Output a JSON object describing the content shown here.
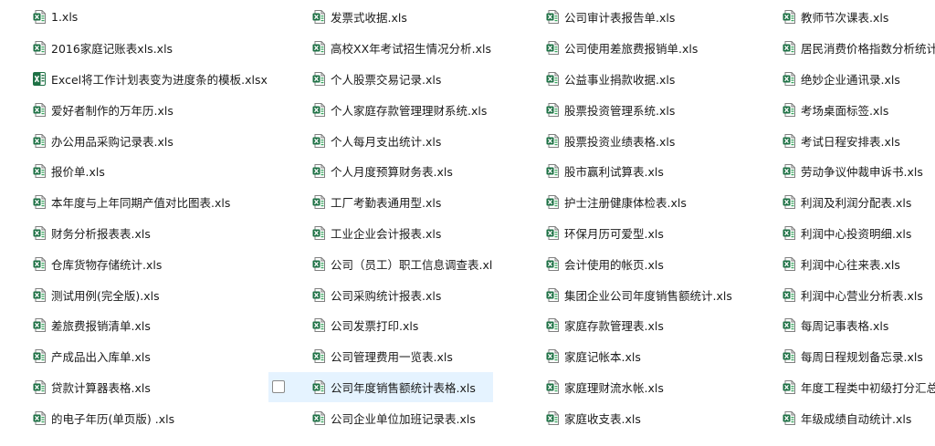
{
  "columns": [
    {
      "files": [
        {
          "name": "1.xls",
          "icon": "excel-file-icon"
        },
        {
          "name": "2016家庭记账表xls.xls",
          "icon": "excel-file-icon"
        },
        {
          "name": "Excel将工作计划表变为进度条的模板.xlsx",
          "icon": "excel-xlsx-file-icon"
        },
        {
          "name": "爱好者制作的万年历.xls",
          "icon": "excel-file-icon"
        },
        {
          "name": "办公用品采购记录表.xls",
          "icon": "excel-file-icon"
        },
        {
          "name": "报价单.xls",
          "icon": "excel-file-icon"
        },
        {
          "name": "本年度与上年同期产值对比图表.xls",
          "icon": "excel-file-icon"
        },
        {
          "name": "财务分析报表表.xls",
          "icon": "excel-file-icon"
        },
        {
          "name": "仓库货物存储统计.xls",
          "icon": "excel-file-icon"
        },
        {
          "name": "测试用例(完全版).xls",
          "icon": "excel-file-icon"
        },
        {
          "name": "差旅费报销清单.xls",
          "icon": "excel-file-icon"
        },
        {
          "name": "产成品出入库单.xls",
          "icon": "excel-file-icon"
        },
        {
          "name": "贷款计算器表格.xls",
          "icon": "excel-file-icon"
        },
        {
          "name": "的电子年历(单页版) .xls",
          "icon": "excel-file-icon"
        }
      ]
    },
    {
      "files": [
        {
          "name": "发票式收据.xls",
          "icon": "excel-file-icon"
        },
        {
          "name": "高校XX年考试招生情况分析.xls",
          "icon": "excel-file-icon"
        },
        {
          "name": "个人股票交易记录.xls",
          "icon": "excel-file-icon"
        },
        {
          "name": "个人家庭存款管理理财系统.xls",
          "icon": "excel-file-icon"
        },
        {
          "name": "个人每月支出统计.xls",
          "icon": "excel-file-icon"
        },
        {
          "name": "个人月度预算财务表.xls",
          "icon": "excel-file-icon"
        },
        {
          "name": "工厂考勤表通用型.xls",
          "icon": "excel-file-icon"
        },
        {
          "name": "工业企业会计报表.xls",
          "icon": "excel-file-icon"
        },
        {
          "name": "公司（员工）职工信息调查表.xls",
          "icon": "excel-file-icon"
        },
        {
          "name": "公司采购统计报表.xls",
          "icon": "excel-file-icon"
        },
        {
          "name": "公司发票打印.xls",
          "icon": "excel-file-icon"
        },
        {
          "name": "公司管理费用一览表.xls",
          "icon": "excel-file-icon"
        },
        {
          "name": "公司年度销售额统计表格.xls",
          "icon": "excel-file-icon",
          "hovered": true
        },
        {
          "name": "公司企业单位加班记录表.xls",
          "icon": "excel-file-icon"
        }
      ]
    },
    {
      "files": [
        {
          "name": "公司审计表报告单.xls",
          "icon": "excel-file-icon"
        },
        {
          "name": "公司使用差旅费报销单.xls",
          "icon": "excel-file-icon"
        },
        {
          "name": "公益事业捐款收据.xls",
          "icon": "excel-file-icon"
        },
        {
          "name": "股票投资管理系统.xls",
          "icon": "excel-file-icon"
        },
        {
          "name": "股票投资业绩表格.xls",
          "icon": "excel-file-icon"
        },
        {
          "name": "股市赢利试算表.xls",
          "icon": "excel-file-icon"
        },
        {
          "name": "护士注册健康体检表.xls",
          "icon": "excel-file-icon"
        },
        {
          "name": "环保月历可爱型.xls",
          "icon": "excel-file-icon"
        },
        {
          "name": "会计使用的帐页.xls",
          "icon": "excel-file-icon"
        },
        {
          "name": "集团企业公司年度销售额统计.xls",
          "icon": "excel-file-icon"
        },
        {
          "name": "家庭存款管理表.xls",
          "icon": "excel-file-icon"
        },
        {
          "name": "家庭记帐本.xls",
          "icon": "excel-file-icon"
        },
        {
          "name": "家庭理财流水帐.xls",
          "icon": "excel-file-icon"
        },
        {
          "name": "家庭收支表.xls",
          "icon": "excel-file-icon"
        }
      ]
    },
    {
      "files": [
        {
          "name": "教师节次课表.xls",
          "icon": "excel-file-icon"
        },
        {
          "name": "居民消费价格指数分析统计.xls",
          "icon": "excel-file-icon"
        },
        {
          "name": "绝妙企业通讯录.xls",
          "icon": "excel-file-icon"
        },
        {
          "name": "考场桌面标签.xls",
          "icon": "excel-file-icon"
        },
        {
          "name": "考试日程安排表.xls",
          "icon": "excel-file-icon"
        },
        {
          "name": "劳动争议仲裁申诉书.xls",
          "icon": "excel-file-icon"
        },
        {
          "name": "利润及利润分配表.xls",
          "icon": "excel-file-icon"
        },
        {
          "name": "利润中心投资明细.xls",
          "icon": "excel-file-icon"
        },
        {
          "name": "利润中心往来表.xls",
          "icon": "excel-file-icon"
        },
        {
          "name": "利润中心营业分析表.xls",
          "icon": "excel-file-icon"
        },
        {
          "name": "每周记事表格.xls",
          "icon": "excel-file-icon"
        },
        {
          "name": "每周日程规划备忘录.xls",
          "icon": "excel-file-icon"
        },
        {
          "name": "年度工程类中初级打分汇总表.xls",
          "icon": "excel-file-icon"
        },
        {
          "name": "年级成绩自动统计.xls",
          "icon": "excel-file-icon"
        }
      ]
    }
  ],
  "colors": {
    "hover_background": "#e5f3ff",
    "excel_green": "#1e7145",
    "excel_light_green": "#33a35a"
  }
}
